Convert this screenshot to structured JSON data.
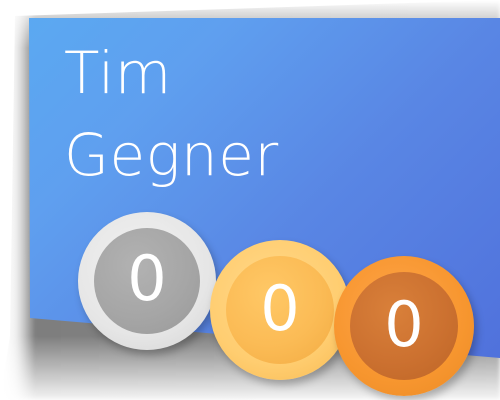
{
  "profile": {
    "first_name": "Tim",
    "last_name": "Gegner"
  },
  "medals": [
    {
      "type": "silver",
      "count": "0",
      "color": "#a6a6a6"
    },
    {
      "type": "gold",
      "count": "0",
      "color": "#fbbb55"
    },
    {
      "type": "bronze",
      "count": "0",
      "color": "#cc7130"
    }
  ],
  "theme": {
    "card_gradient_start": "#5aabf2",
    "card_gradient_end": "#4f6fdb"
  }
}
